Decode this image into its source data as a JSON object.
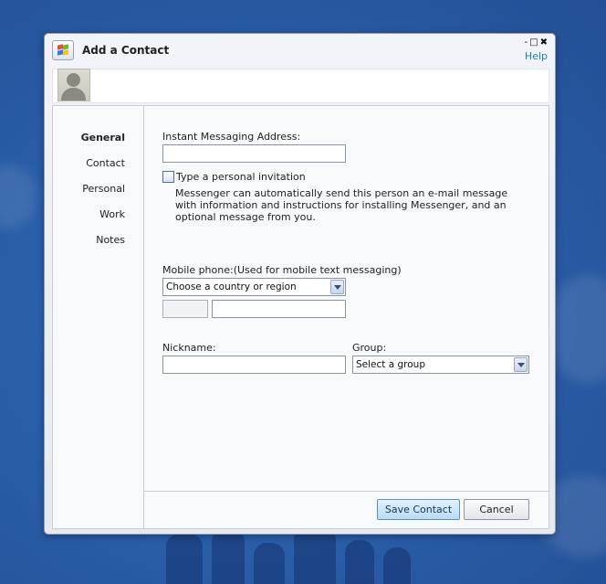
{
  "window": {
    "title": "Add a Contact",
    "help_label": "Help",
    "controls": "-□✖",
    "app_icon": "windows-logo-icon"
  },
  "nav": {
    "items": [
      {
        "label": "General",
        "active": true
      },
      {
        "label": "Contact",
        "active": false
      },
      {
        "label": "Personal",
        "active": false
      },
      {
        "label": "Work",
        "active": false
      },
      {
        "label": "Notes",
        "active": false
      }
    ]
  },
  "form": {
    "im_address": {
      "label": "Instant Messaging Address:",
      "value": ""
    },
    "invitation": {
      "label": "Type a personal invitation",
      "checked": false,
      "description": "Messenger can automatically send this person an e-mail message with information and instructions for installing Messenger, and an optional message from you."
    },
    "mobile": {
      "label": "Mobile phone:(Used for mobile text messaging)",
      "country_selected": "Choose a country or region",
      "country_code": "",
      "number": ""
    },
    "nickname": {
      "label": "Nickname:",
      "value": ""
    },
    "group": {
      "label": "Group:",
      "selected": "Select a group"
    }
  },
  "buttons": {
    "save": "Save Contact",
    "cancel": "Cancel"
  },
  "colors": {
    "desktop": "#2a5fa9",
    "link": "#1f7fbf",
    "primary_button": "#b9dbf6"
  }
}
